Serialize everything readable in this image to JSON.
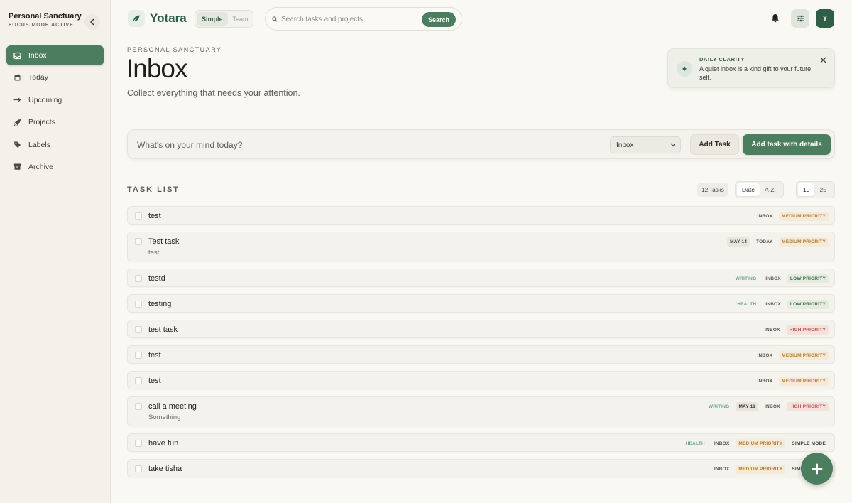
{
  "workspace": {
    "name": "Personal Sanctuary",
    "status": "FOCUS MODE ACTIVE"
  },
  "sidebar": {
    "items": [
      {
        "label": "Inbox",
        "icon": "inbox-icon",
        "active": true
      },
      {
        "label": "Today",
        "icon": "calendar-icon"
      },
      {
        "label": "Upcoming",
        "icon": "arrow-right-icon"
      },
      {
        "label": "Projects",
        "icon": "rocket-icon"
      },
      {
        "label": "Labels",
        "icon": "tag-icon"
      },
      {
        "label": "Archive",
        "icon": "archive-icon"
      }
    ]
  },
  "topbar": {
    "app_name": "Yotara",
    "modes": [
      "Simple",
      "Team"
    ],
    "active_mode": "Simple",
    "search_placeholder": "Search tasks and projects...",
    "search_button": "Search",
    "avatar_initial": "Y"
  },
  "header": {
    "eyebrow": "PERSONAL SANCTUARY",
    "title": "Inbox",
    "subtitle": "Collect everything that needs your attention."
  },
  "clarity": {
    "label": "DAILY CLARITY",
    "text": "A quiet inbox is a kind gift to your future self."
  },
  "quick_add": {
    "placeholder": "What's on your mind today?",
    "project_select": "Inbox",
    "add_button": "Add Task",
    "add_details_button": "Add task with details"
  },
  "task_list": {
    "title": "TASK LIST",
    "count": "12 Tasks",
    "sort_options": [
      "Date",
      "A-Z"
    ],
    "sort_selected": "Date",
    "page_sizes": [
      "10",
      "25"
    ],
    "page_size_selected": "10",
    "tasks": [
      {
        "name": "test",
        "note": "",
        "tags": [
          {
            "text": "INBOX",
            "kind": "plain"
          },
          {
            "text": "MEDIUM PRIORITY",
            "kind": "med"
          }
        ]
      },
      {
        "name": "Test task",
        "note": "test",
        "tags": [
          {
            "text": "MAY 14",
            "kind": "date"
          },
          {
            "text": "TODAY",
            "kind": "plain"
          },
          {
            "text": "MEDIUM PRIORITY",
            "kind": "med"
          }
        ]
      },
      {
        "name": "testd",
        "note": "",
        "tags": [
          {
            "text": "WRITING",
            "kind": "proj"
          },
          {
            "text": "INBOX",
            "kind": "plain"
          },
          {
            "text": "LOW PRIORITY",
            "kind": "low"
          }
        ]
      },
      {
        "name": "testing",
        "note": "",
        "tags": [
          {
            "text": "HEALTH",
            "kind": "proj"
          },
          {
            "text": "INBOX",
            "kind": "plain"
          },
          {
            "text": "LOW PRIORITY",
            "kind": "low"
          }
        ]
      },
      {
        "name": "test task",
        "note": "",
        "tags": [
          {
            "text": "INBOX",
            "kind": "plain"
          },
          {
            "text": "HIGH PRIORITY",
            "kind": "high"
          }
        ]
      },
      {
        "name": "test",
        "note": "",
        "tags": [
          {
            "text": "INBOX",
            "kind": "plain"
          },
          {
            "text": "MEDIUM PRIORITY",
            "kind": "med"
          }
        ]
      },
      {
        "name": "test",
        "note": "",
        "tags": [
          {
            "text": "INBOX",
            "kind": "plain"
          },
          {
            "text": "MEDIUM PRIORITY",
            "kind": "med"
          }
        ]
      },
      {
        "name": "call a meeting",
        "note": "Something",
        "tags": [
          {
            "text": "WRITING",
            "kind": "proj"
          },
          {
            "text": "MAY 11",
            "kind": "date"
          },
          {
            "text": "INBOX",
            "kind": "plain"
          },
          {
            "text": "HIGH PRIORITY",
            "kind": "high"
          }
        ]
      },
      {
        "name": "have fun",
        "note": "",
        "tags": [
          {
            "text": "HEALTH",
            "kind": "proj"
          },
          {
            "text": "INBOX",
            "kind": "plain"
          },
          {
            "text": "MEDIUM PRIORITY",
            "kind": "med"
          },
          {
            "text": "SIMPLE MODE",
            "kind": "simple"
          }
        ]
      },
      {
        "name": "take tisha",
        "note": "",
        "tags": [
          {
            "text": "INBOX",
            "kind": "plain"
          },
          {
            "text": "MEDIUM PRIORITY",
            "kind": "med"
          },
          {
            "text": "SIMPLE MODE",
            "kind": "simple"
          }
        ]
      }
    ]
  },
  "colors": {
    "accent": "#4b7d5f",
    "brand": "#2f5d46",
    "background": "#faf8f2"
  }
}
